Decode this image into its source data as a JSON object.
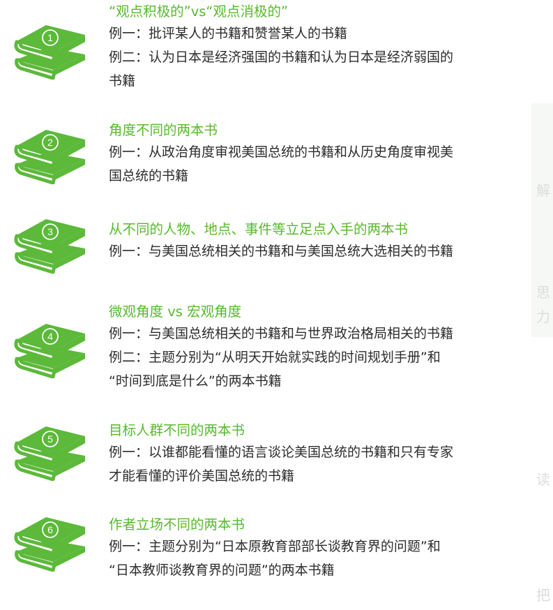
{
  "colors": {
    "accent_green": "#56b92c",
    "book_green": "#5cb93a",
    "text": "#2c2c2c"
  },
  "icon_name": "green-books-icon",
  "items": [
    {
      "number": "1",
      "title": "“观点积极的”vs“观点消极的”",
      "lines": [
        "例一：批评某人的书籍和赞誉某人的书籍",
        "例二：认为日本是经济强国的书籍和认为日本是经济弱国的",
        "书籍"
      ]
    },
    {
      "number": "2",
      "title": "角度不同的两本书",
      "lines": [
        "例一：从政治角度审视美国总统的书籍和从历史角度审视美",
        "国总统的书籍"
      ]
    },
    {
      "number": "3",
      "title": "从不同的人物、地点、事件等立足点入手的两本书",
      "lines": [
        "例一：与美国总统相关的书籍和与美国总统大选相关的书籍"
      ]
    },
    {
      "number": "4",
      "title": "微观角度 vs 宏观角度",
      "lines": [
        "例一：与美国总统相关的书籍和与世界政治格局相关的书籍",
        "例二：主题分别为“从明天开始就实践的时间规划手册”和",
        "“时间到底是什么”的两本书籍"
      ]
    },
    {
      "number": "5",
      "title": "目标人群不同的两本书",
      "lines": [
        "例一：以谁都能看懂的语言谈论美国总统的书籍和只有专家",
        "才能看懂的评价美国总统的书籍"
      ]
    },
    {
      "number": "6",
      "title": "作者立场不同的两本书",
      "lines": [
        "例一：主题分别为“日本原教育部部长谈教育界的问题”和",
        "“日本教师谈教育界的问题”的两本书籍"
      ]
    }
  ],
  "edge_glyphs": [
    "解",
    "思",
    "力",
    "读",
    "把"
  ]
}
